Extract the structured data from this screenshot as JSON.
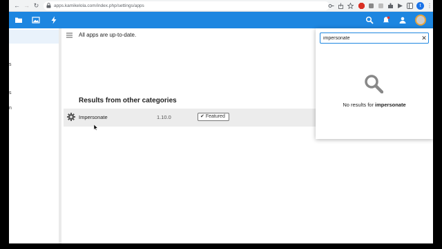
{
  "browser": {
    "back_glyph": "←",
    "forward_glyph": "→",
    "reload_glyph": "↻",
    "url": "apps.kamikelola.com/index.php/settings/apps",
    "profile_letter": "t"
  },
  "app_header": {
    "icons": [
      "files-icon",
      "photos-icon",
      "activity-icon",
      "search-icon",
      "notifications-icon",
      "contacts-icon"
    ],
    "brand_color": "#1d86e0"
  },
  "left_nav": {
    "fragments": [
      "s",
      "s",
      "n"
    ]
  },
  "main": {
    "status_text": "All apps are up-to-date.",
    "results_heading": "Results from other categories",
    "results": [
      {
        "name": "Impersonate",
        "version": "1.10.0",
        "badge": "Featured"
      }
    ]
  },
  "search_panel": {
    "query": "impersonate",
    "clear_glyph": "✕",
    "no_results_prefix": "No results for ",
    "no_results_term": "impersonate"
  }
}
